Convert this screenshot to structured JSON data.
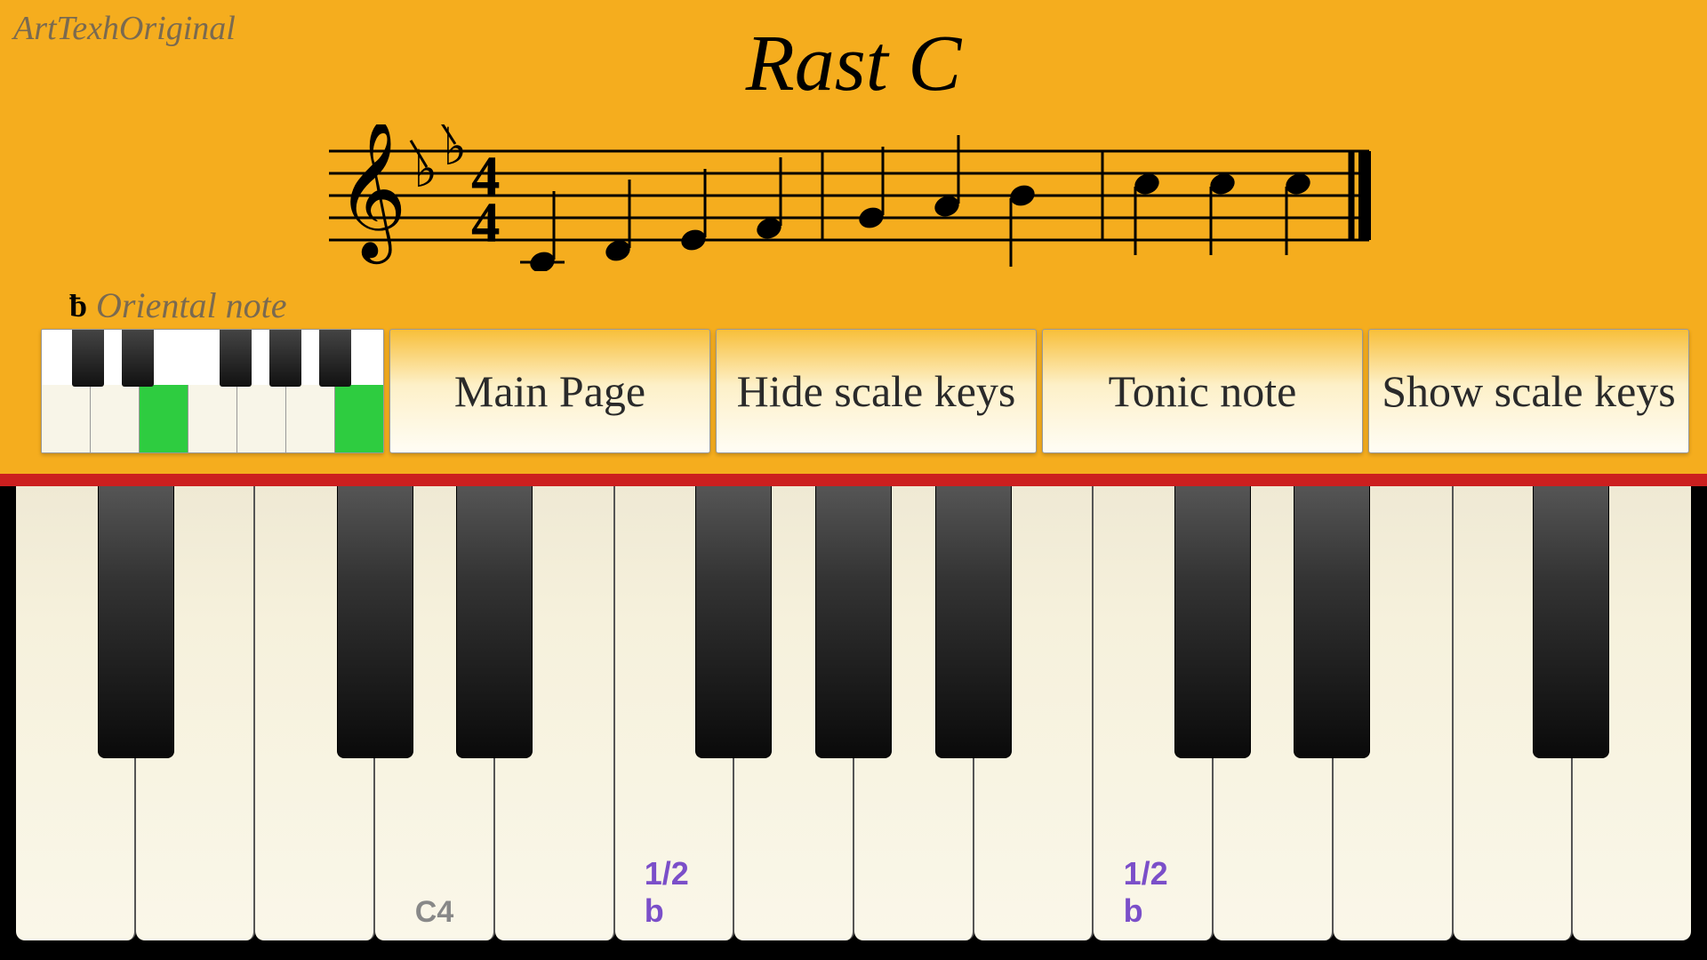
{
  "watermark": "ArtTexhOriginal",
  "title": "Rast C",
  "oriental_label": "Oriental note",
  "tabs": {
    "main_page": "Main Page",
    "hide_scale": "Hide scale keys",
    "tonic_note": "Tonic note",
    "show_scale": "Show scale keys"
  },
  "key_labels": {
    "c4": "C4",
    "half_flat_1": "1/2 b",
    "half_flat_2": "1/2 b"
  },
  "notation": {
    "clef": "treble",
    "time_signature": "4/4",
    "key_signature_flats": 2
  }
}
